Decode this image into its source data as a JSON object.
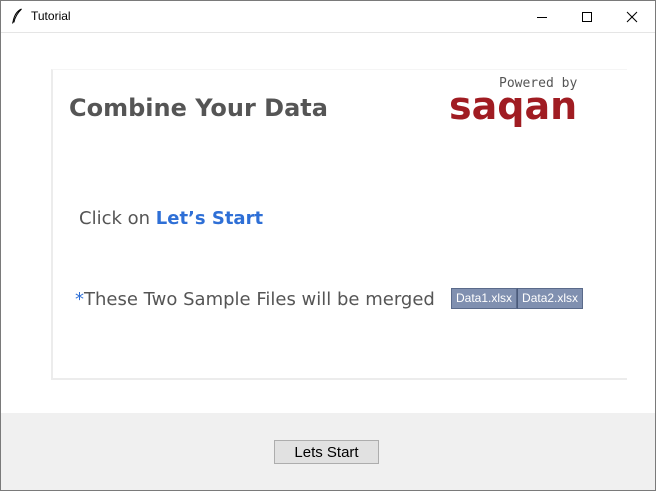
{
  "window": {
    "title": "Tutorial",
    "icons": {
      "app": "feather-icon",
      "minimize": "minimize-icon",
      "maximize": "maximize-icon",
      "close": "close-icon"
    }
  },
  "card": {
    "title": "Combine Your Data",
    "powered_by": "Powered by",
    "brand": "saqan",
    "brand_color": "#a01c22",
    "instruction_prefix": "Click on ",
    "instruction_link": "Let’s Start",
    "link_color": "#2e6fd6",
    "note_asterisk": "*",
    "note_text": "These Two Sample Files will be merged",
    "files": [
      "Data1.xlsx",
      "Data2.xlsx"
    ]
  },
  "footer": {
    "start_button_label": "Lets Start"
  }
}
